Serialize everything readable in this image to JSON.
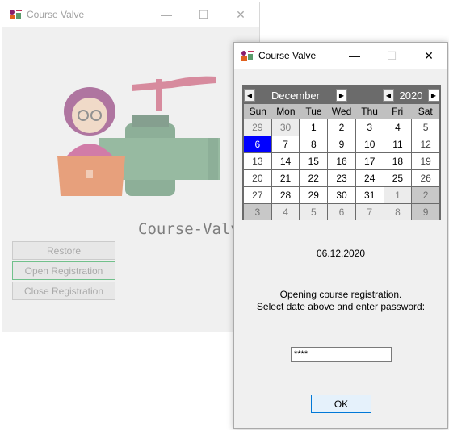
{
  "back_window": {
    "title": "Course Valve",
    "brand_text": "Course-Valve",
    "buttons": [
      "Restore",
      "Open Registration",
      "Close Registration"
    ]
  },
  "dialog": {
    "title": "Course Valve",
    "calendar": {
      "month": "December",
      "year": "2020",
      "weekdays": [
        "Sun",
        "Mon",
        "Tue",
        "Wed",
        "Thu",
        "Fri",
        "Sat"
      ],
      "weeks": [
        [
          "29",
          "30",
          "1",
          "2",
          "3",
          "4",
          "5"
        ],
        [
          "6",
          "7",
          "8",
          "9",
          "10",
          "11",
          "12"
        ],
        [
          "13",
          "14",
          "15",
          "16",
          "17",
          "18",
          "19"
        ],
        [
          "20",
          "21",
          "22",
          "23",
          "24",
          "25",
          "26"
        ],
        [
          "27",
          "28",
          "29",
          "30",
          "31",
          "1",
          "2"
        ],
        [
          "3",
          "4",
          "5",
          "6",
          "7",
          "8",
          "9"
        ]
      ],
      "selected": "6"
    },
    "date_text": "06.12.2020",
    "message_line1": "Opening course registration.",
    "message_line2": "Select date above and enter password:",
    "password_value": "****",
    "ok_label": "OK"
  },
  "colors": {
    "selected_day": "#0000ff",
    "calendar_border": "#6b6b6b",
    "ok_border": "#0078d7"
  }
}
